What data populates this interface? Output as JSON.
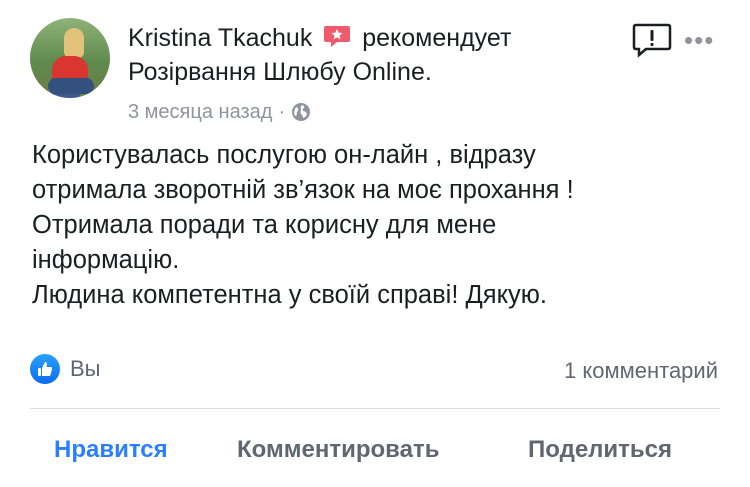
{
  "post": {
    "author": "Kristina Tkachuk",
    "recommends_text": "рекомендует",
    "page_name": "Розірвання Шлюбу Online.",
    "timestamp": "3 месяца назад",
    "separator": "·",
    "body_lines": [
      "Користувалась послугою он-лайн , відразу",
      "отримала зворотній зв’язок на моє прохання !",
      "Отримала поради та корисну для мене",
      "інформацію.",
      "Людина компетентна у своїй справі! Дякую."
    ]
  },
  "reactions": {
    "reactors": "Вы",
    "comments_count": "1 комментарий"
  },
  "actions": {
    "like": "Нравится",
    "comment": "Комментировать",
    "share": "Поделиться"
  },
  "icons": {
    "recommend": "recommend-badge-icon",
    "privacy": "globe-icon",
    "report": "report-icon",
    "more": "more-options-icon",
    "like_reaction": "like-icon"
  },
  "colors": {
    "recommend_badge": "#f05a6b",
    "like_active": "#2a7fff",
    "secondary_text": "#90949c"
  }
}
